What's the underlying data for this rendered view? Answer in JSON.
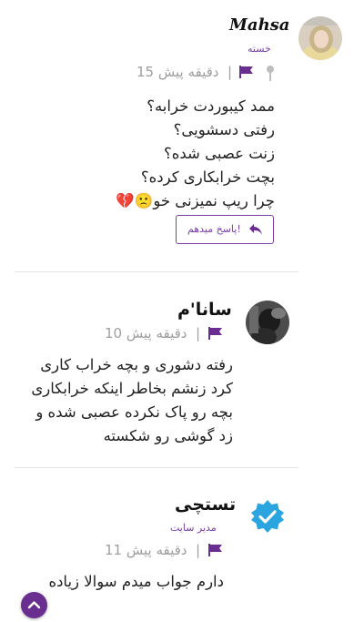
{
  "colors": {
    "accent": "#7a3fa6",
    "accent_dark": "#6a2e91",
    "meta": "#9e9e9e",
    "verified": "#2aa5e0"
  },
  "comments": [
    {
      "author": "Mahsa",
      "role": "خسته",
      "time_ago": "15 دقیقه پیش",
      "separator": "|",
      "icons": [
        "pin-icon",
        "flag-icon"
      ],
      "lines": [
        "ممد کیبوردت خرابه؟",
        "رفتی دسشویی؟",
        "زنت عصبی شده؟",
        "بچت خرابکاری کرده؟",
        "چرا ریپ نمیزنی خو🙁💔"
      ],
      "reply_label": "پاسخ میدهم!"
    },
    {
      "author": "سانا'م",
      "time_ago": "10 دقیقه پیش",
      "separator": "|",
      "icons": [
        "flag-icon"
      ],
      "lines": [
        "رفته دشوری و بچه خراب کاری",
        "کرد زنشم بخاطر اینکه خرابکاری",
        "بچه رو پاک نکرده عصبی شده و",
        "زد گوشی رو شکسته"
      ]
    },
    {
      "author": "تستچی",
      "role": "مدیر سایت",
      "time_ago": "11 دقیقه پیش",
      "separator": "|",
      "icons": [
        "flag-icon",
        "verified-badge-icon"
      ],
      "lines": [
        "دارم جواب میدم سوالا زیاده"
      ]
    }
  ],
  "scroll_top_icon": "chevron-up-icon"
}
